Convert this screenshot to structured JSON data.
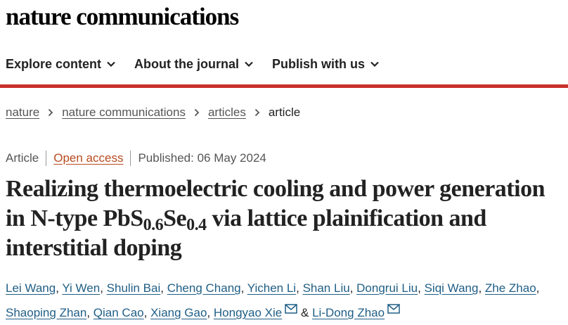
{
  "brand": {
    "name": "nature communications"
  },
  "nav": {
    "items": [
      {
        "label": "Explore content"
      },
      {
        "label": "About the journal"
      },
      {
        "label": "Publish with us"
      }
    ]
  },
  "colors": {
    "accent_bar": "#c9302c",
    "link": "#1f5e86",
    "open_access": "#b94a1f"
  },
  "breadcrumb": {
    "items": [
      {
        "label": "nature"
      },
      {
        "label": "nature communications"
      },
      {
        "label": "articles"
      }
    ],
    "current": "article"
  },
  "article_meta": {
    "type": "Article",
    "access": "Open access",
    "published": "Published: 06 May 2024"
  },
  "article": {
    "title_part1": "Realizing thermoelectric cooling and power generation in N-type PbS",
    "sub1": "0.6",
    "title_part2": "Se",
    "sub2": "0.4",
    "title_part3": " via lattice plainification and interstitial doping"
  },
  "authors": {
    "list": [
      "Lei Wang",
      "Yi Wen",
      "Shulin Bai",
      "Cheng Chang",
      "Yichen Li",
      "Shan Liu",
      "Dongrui Liu",
      "Siqi Wang",
      "Zhe Zhao",
      "Shaoping Zhan",
      "Qian Cao",
      "Xiang Gao",
      "Hongyao Xie",
      "Li-Dong Zhao"
    ],
    "separator": ",",
    "conjunction": "&",
    "icon": "mail-icon"
  }
}
